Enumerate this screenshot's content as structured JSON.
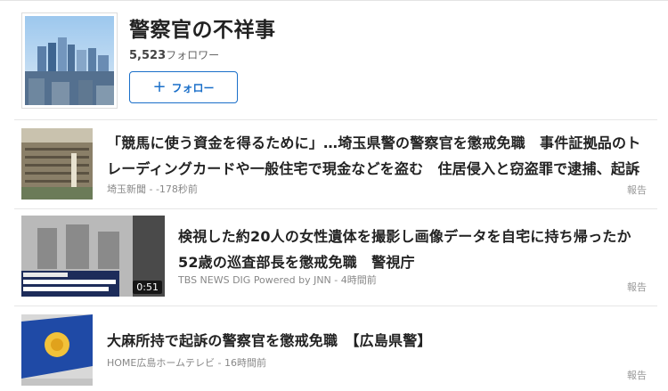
{
  "topic": {
    "title": "警察官の不祥事",
    "followers": "5,523",
    "followers_suffix": "フォロワー",
    "follow_label": "フォロー",
    "thumbnail_icon": "city-skyline-image"
  },
  "articles": [
    {
      "title": "「競馬に使う資金を得るために」…埼玉県警の警察官を懲戒免職　事件証拠品のトレーディングカードや一般住宅で現金などを盗む　住居侵入と窃盗罪で逮捕、起訴",
      "source": "埼玉新聞 - -178秒前",
      "report": "報告",
      "thumbnail_icon": "police-building-image"
    },
    {
      "title": "検視した約20人の女性遺体を撮影し画像データを自宅に持ち帰ったか　52歳の巡査部長を懲戒免職　警視庁",
      "source": "TBS NEWS DIG Powered by JNN - 4時間前",
      "report": "報告",
      "duration": "0:51",
      "thumbnail_icon": "police-sign-video-thumbnail"
    },
    {
      "title": "大麻所持で起訴の警察官を懲戒免職　【広島県警】",
      "source": "HOME広島ホームテレビ - 16時間前",
      "report": "報告",
      "thumbnail_icon": "police-flag-image"
    }
  ],
  "colors": {
    "accent": "#1a6fc9",
    "text": "#222222",
    "muted": "#888888"
  }
}
